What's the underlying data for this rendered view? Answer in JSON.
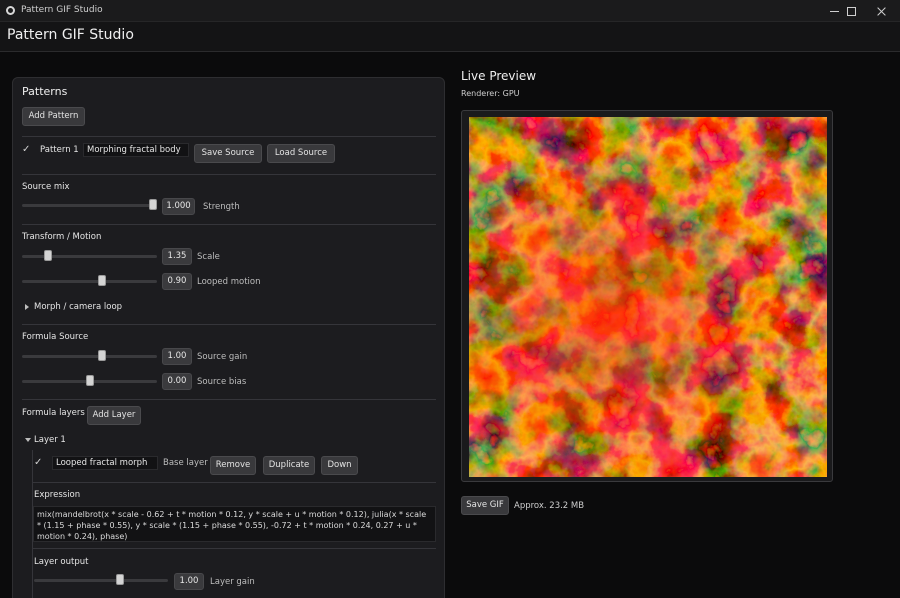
{
  "window": {
    "title": "Pattern GIF Studio"
  },
  "header": {
    "title": "Pattern GIF Studio"
  },
  "patterns": {
    "title": "Patterns",
    "add_pattern": "Add Pattern",
    "pattern": {
      "label": "Pattern 1",
      "name_value": "Morphing fractal body",
      "save_source": "Save Source",
      "load_source": "Load Source"
    },
    "source_mix": {
      "title": "Source mix",
      "strength_value": "1.000",
      "strength_fraction": 1.0,
      "strength_label": "Strength"
    },
    "transform": {
      "title": "Transform / Motion",
      "scale_value": "1.35",
      "scale_fraction": 0.17,
      "scale_label": "Scale",
      "motion_value": "0.90",
      "motion_fraction": 0.6,
      "motion_label": "Looped motion",
      "morph_toggle": "Morph / camera loop"
    },
    "formula_source": {
      "title": "Formula Source",
      "gain_value": "1.00",
      "gain_fraction": 0.6,
      "gain_label": "Source gain",
      "bias_value": "0.00",
      "bias_fraction": 0.5,
      "bias_label": "Source bias"
    },
    "formula_layers": {
      "title": "Formula layers",
      "add_layer": "Add Layer",
      "layer": {
        "header": "Layer 1",
        "name_value": "Looped fractal morph",
        "base_label": "Base layer",
        "remove": "Remove",
        "duplicate": "Duplicate",
        "down": "Down",
        "expression_title": "Expression",
        "expression": "mix(mandelbrot(x * scale - 0.62 + t * motion * 0.12, y * scale + u * motion * 0.12), julia(x * scale * (1.15 + phase * 0.55), y * scale * (1.15 + phase * 0.55), -0.72 + t * motion * 0.24, 0.27 + u * motion * 0.24), phase)",
        "output_title": "Layer output",
        "gain_value": "1.00",
        "gain_fraction": 0.65,
        "gain_label": "Layer gain"
      }
    }
  },
  "preview": {
    "title": "Live Preview",
    "renderer": "Renderer: GPU",
    "save_gif": "Save GIF",
    "size": "Approx. 23.2 MB"
  },
  "colors": {
    "fractal_dark": "#1a0500",
    "fractal_mid": "#e8280a",
    "fractal_bright": "#ffb040"
  }
}
